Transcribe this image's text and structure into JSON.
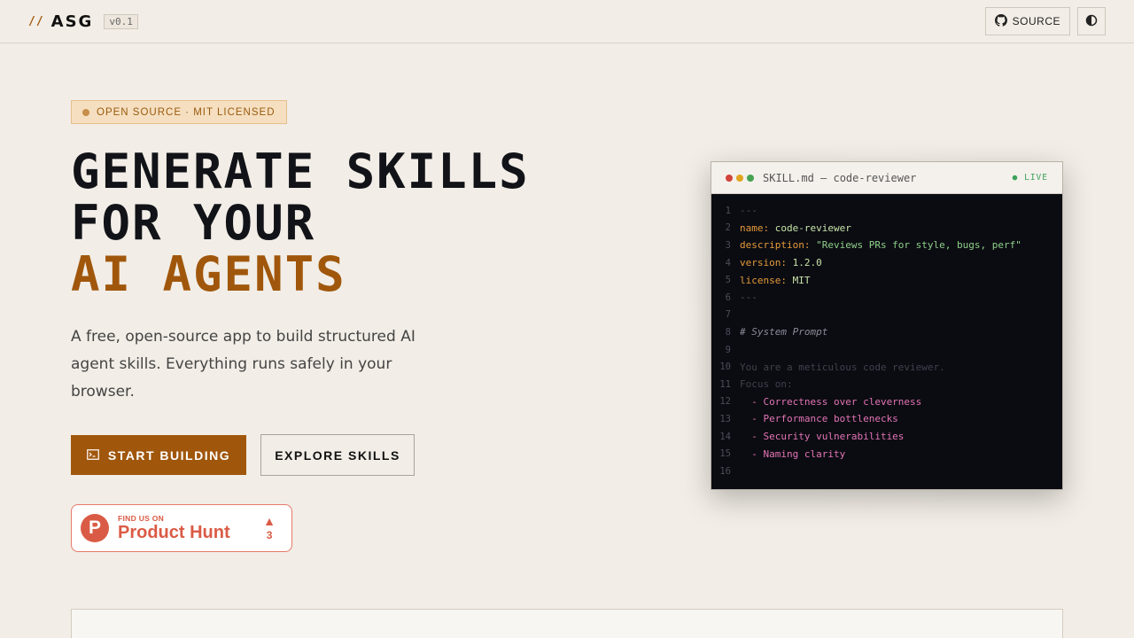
{
  "header": {
    "brand_slash": "//",
    "brand_name": "ASG",
    "version": "v0.1",
    "source_label": "SOURCE",
    "icons": {
      "source": "github-icon",
      "theme": "contrast-icon"
    }
  },
  "hero": {
    "badge": "OPEN SOURCE · MIT LICENSED",
    "headline_line1": "GENERATE SKILLS",
    "headline_line2": "FOR YOUR",
    "headline_accent": "AI AGENTS",
    "subtitle": "A free, open-source app to build structured AI agent skills. Everything runs safely in your browser.",
    "primary_cta": "START BUILDING",
    "secondary_cta": "EXPLORE SKILLS",
    "product_hunt": {
      "small": "FIND US ON",
      "big": "Product Hunt",
      "logo_letter": "P",
      "arrow": "▲",
      "votes": "3"
    }
  },
  "editor": {
    "title": "SKILL.md — code-reviewer",
    "status": "● LIVE",
    "lines": [
      {
        "n": "1",
        "parts": [
          {
            "t": "---",
            "c": "muted"
          }
        ]
      },
      {
        "n": "2",
        "parts": [
          {
            "t": "name: ",
            "c": "key"
          },
          {
            "t": "code-reviewer",
            "c": "val"
          }
        ]
      },
      {
        "n": "3",
        "parts": [
          {
            "t": "description: ",
            "c": "key"
          },
          {
            "t": "\"Reviews PRs for style, bugs, perf\"",
            "c": "str"
          }
        ]
      },
      {
        "n": "4",
        "parts": [
          {
            "t": "version: ",
            "c": "key"
          },
          {
            "t": "1.2.0",
            "c": "val"
          }
        ]
      },
      {
        "n": "5",
        "parts": [
          {
            "t": "license: ",
            "c": "key"
          },
          {
            "t": "MIT",
            "c": "val"
          }
        ]
      },
      {
        "n": "6",
        "parts": [
          {
            "t": "---",
            "c": "muted"
          }
        ]
      },
      {
        "n": "7",
        "parts": []
      },
      {
        "n": "8",
        "parts": [
          {
            "t": "# System Prompt",
            "c": "comment"
          }
        ]
      },
      {
        "n": "9",
        "parts": []
      },
      {
        "n": "10",
        "parts": [
          {
            "t": "You are a meticulous code reviewer.",
            "c": "faint"
          }
        ]
      },
      {
        "n": "11",
        "parts": [
          {
            "t": "Focus on:",
            "c": "faint"
          }
        ]
      },
      {
        "n": "12",
        "parts": [
          {
            "t": "  - Correctness over cleverness",
            "c": "list"
          }
        ]
      },
      {
        "n": "13",
        "parts": [
          {
            "t": "  - Performance bottlenecks",
            "c": "list"
          }
        ]
      },
      {
        "n": "14",
        "parts": [
          {
            "t": "  - Security vulnerabilities",
            "c": "list"
          }
        ]
      },
      {
        "n": "15",
        "parts": [
          {
            "t": "  - Naming clarity",
            "c": "list"
          }
        ]
      },
      {
        "n": "16",
        "parts": []
      }
    ]
  },
  "colors": {
    "accent": "#a0570c",
    "background": "#f2ede6",
    "editor_bg": "#0b0c12",
    "product_hunt": "#da5b45",
    "dot_red": "#d0443c",
    "dot_yellow": "#e0a521",
    "dot_green": "#45a353"
  }
}
